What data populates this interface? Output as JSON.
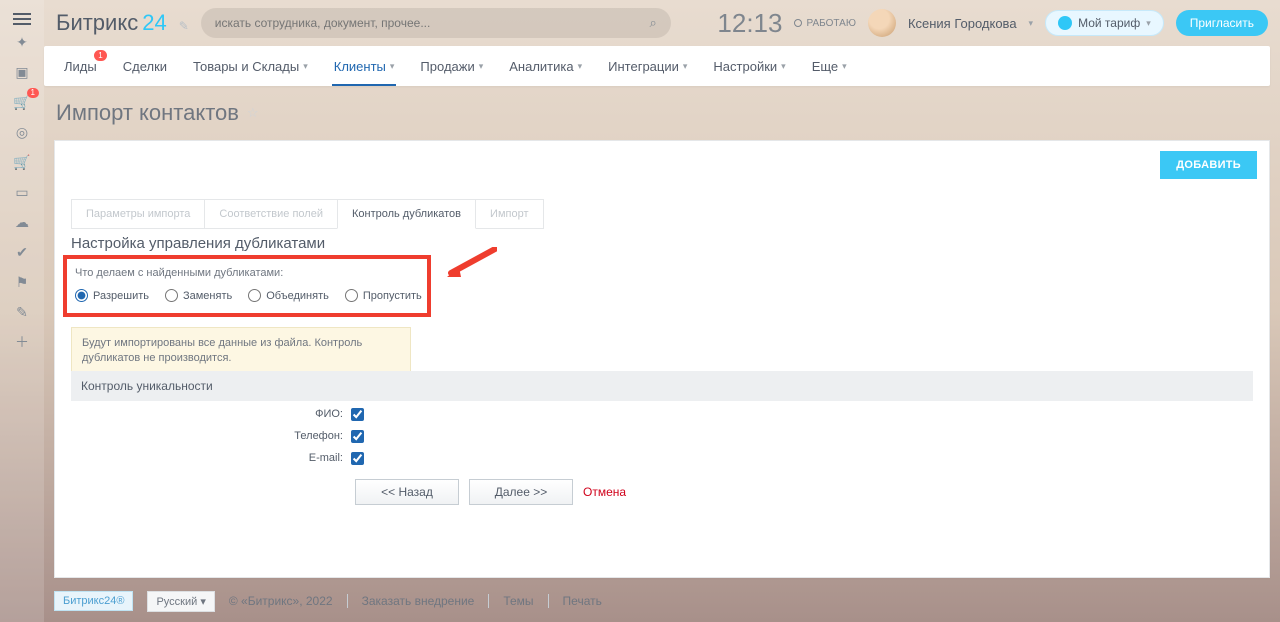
{
  "brand": {
    "name": "Битрикс",
    "suffix": "24"
  },
  "search": {
    "placeholder": "искать сотрудника, документ, прочее..."
  },
  "clock": "12:13",
  "status": "РАБОТАЮ",
  "user": "Ксения Городкова",
  "tariff_label": "Мой тариф",
  "invite_label": "Пригласить",
  "nav": {
    "items": [
      "Лиды",
      "Сделки",
      "Товары и Склады",
      "Клиенты",
      "Продажи",
      "Аналитика",
      "Интеграции",
      "Настройки",
      "Еще"
    ],
    "active_index": 3,
    "badge_index": 0,
    "badge_value": "1"
  },
  "page_title": "Импорт контактов",
  "add_button": "ДОБАВИТЬ",
  "tabs": {
    "items": [
      "Параметры импорта",
      "Соответствие полей",
      "Контроль дубликатов",
      "Импорт"
    ],
    "active_index": 2
  },
  "section_title": "Настройка управления дубликатами",
  "dup_label": "Что делаем с найденными дубликатами:",
  "dup_options": [
    "Разрешить",
    "Заменять",
    "Объединять",
    "Пропустить"
  ],
  "dup_selected_index": 0,
  "info_text": "Будут импортированы все данные из файла. Контроль дубликатов не производится.",
  "uniq_header": "Контроль уникальности",
  "uniq_fields": [
    {
      "label": "ФИО:",
      "checked": true
    },
    {
      "label": "Телефон:",
      "checked": true
    },
    {
      "label": "E-mail:",
      "checked": true
    }
  ],
  "buttons": {
    "back": "<< Назад",
    "next": "Далее >>",
    "cancel": "Отмена"
  },
  "footer": {
    "badge": "Битрикс24®",
    "lang": "Русский",
    "copyright": "© «Битрикс», 2022",
    "links": [
      "Заказать внедрение",
      "Темы",
      "Печать"
    ]
  },
  "left_icons": [
    "plus",
    "doc",
    "cart-badge",
    "gear",
    "cart2",
    "contacts",
    "android",
    "cloud",
    "check",
    "sitemap",
    "edit",
    "plus2"
  ]
}
